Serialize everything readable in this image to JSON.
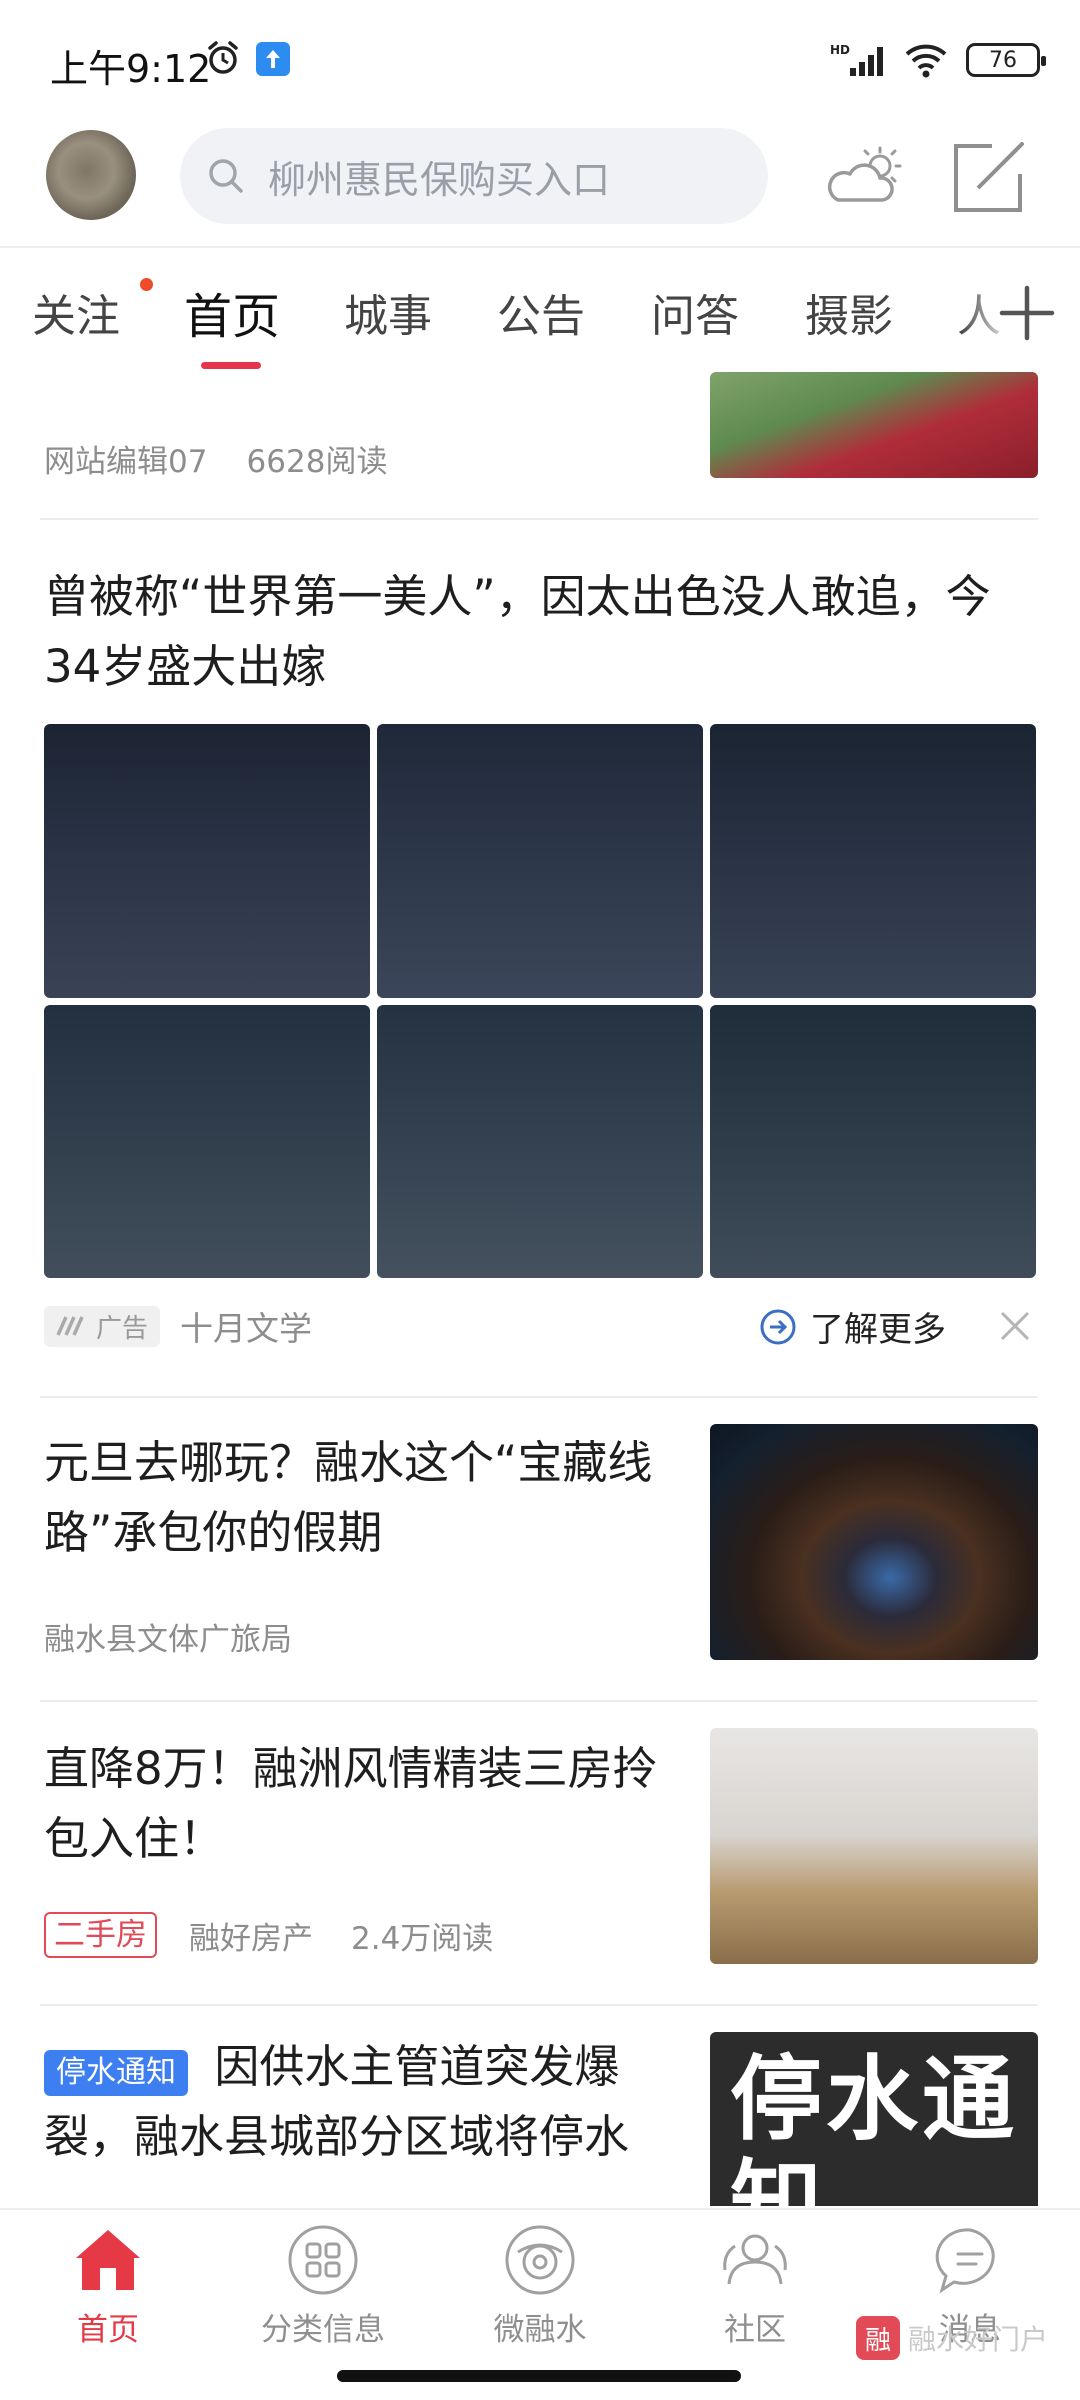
{
  "status_bar": {
    "time": "上午9:12",
    "signal_label": "HD",
    "battery": "76"
  },
  "header": {
    "search_placeholder": "柳州惠民保购买入口"
  },
  "tabs": [
    {
      "label": "关注",
      "has_dot": true
    },
    {
      "label": "首页",
      "active": true
    },
    {
      "label": "城事"
    },
    {
      "label": "公告"
    },
    {
      "label": "问答"
    },
    {
      "label": "摄影"
    },
    {
      "label": "人"
    }
  ],
  "feed": {
    "partial_item": {
      "author": "网站编辑07",
      "reads": "6628阅读"
    },
    "ad_item": {
      "title": "曾被称“世界第一美人”，因太出色没人敢追，今34岁盛大出嫁",
      "ad_label": "广告",
      "source": "十月文学",
      "cta": "了解更多"
    },
    "items": [
      {
        "title": "元旦去哪玩？融水这个“宝藏线路”承包你的假期",
        "source": "融水县文体广旅局"
      },
      {
        "title": "直降8万！融洲风情精装三房拎包入住！",
        "tag": "二手房",
        "source": "融好房产",
        "reads": "2.4万阅读"
      },
      {
        "tag": "停水通知",
        "title": "因供水主管道突发爆裂，融水县城部分区域将停水",
        "thumb_text": "停水通知"
      }
    ]
  },
  "bottom_nav": [
    {
      "label": "首页",
      "icon": "home-icon",
      "active": true
    },
    {
      "label": "分类信息",
      "icon": "category-icon"
    },
    {
      "label": "微融水",
      "icon": "weirongshui-icon"
    },
    {
      "label": "社区",
      "icon": "community-icon"
    },
    {
      "label": "消息",
      "icon": "message-icon"
    }
  ],
  "watermark": {
    "logo": "融",
    "text": "融水好门户"
  },
  "colors": {
    "accent": "#e5354a",
    "tag_blue": "#3d7ff0",
    "muted": "#8d8d8d"
  }
}
